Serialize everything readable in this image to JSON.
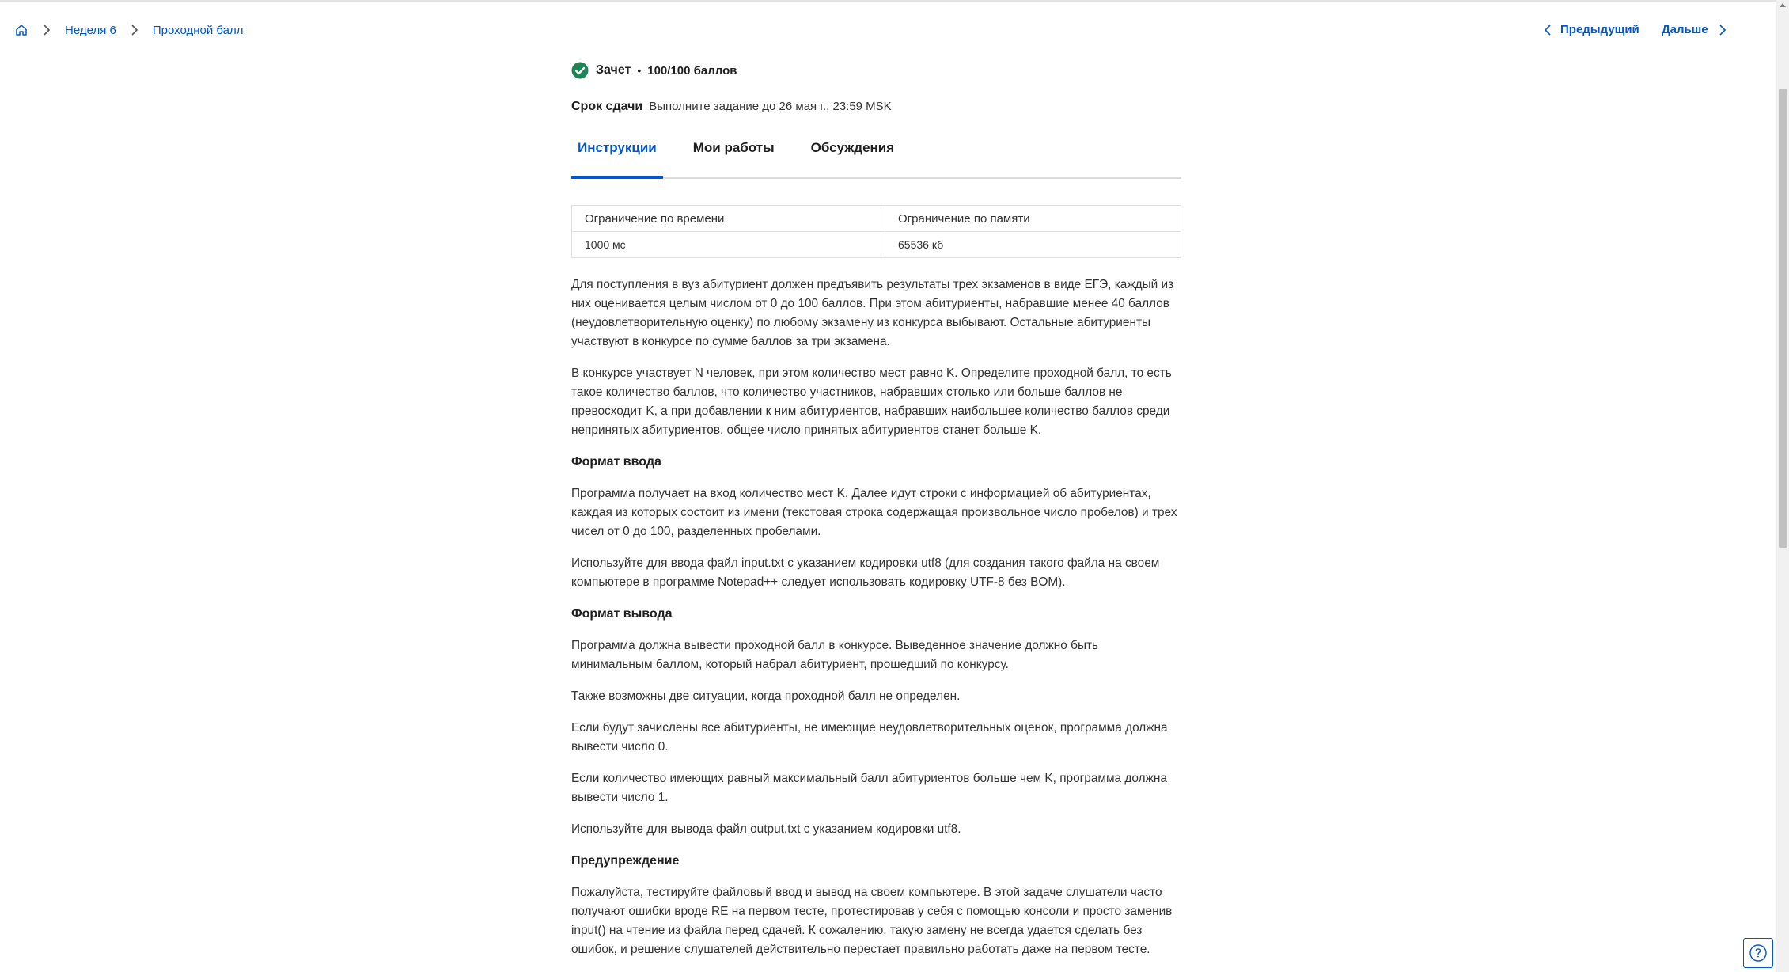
{
  "breadcrumb": {
    "items": [
      {
        "label": "Неделя 6"
      },
      {
        "label": "Проходной балл"
      }
    ]
  },
  "nav": {
    "prev_label": "Предыдущий",
    "next_label": "Дальше"
  },
  "status": {
    "label": "Зачет",
    "separator": "•",
    "score": "100/100 баллов",
    "color": "#1f8354"
  },
  "deadline": {
    "label": "Срок сдачи",
    "text": "Выполните задание до 26 мая г., 23:59 MSK"
  },
  "tabs": [
    {
      "label": "Инструкции",
      "active": true
    },
    {
      "label": "Мои работы",
      "active": false
    },
    {
      "label": "Обсуждения",
      "active": false
    }
  ],
  "limits": {
    "headers": [
      "Ограничение по времени",
      "Ограничение по памяти"
    ],
    "values": [
      "1000 мс",
      "65536 кб"
    ]
  },
  "instructions": {
    "p1": "Для поступления в вуз абитуриент должен предъявить результаты трех экзаменов в виде ЕГЭ, каждый из них оценивается целым числом от 0 до 100 баллов. При этом абитуриенты, набравшие менее 40 баллов (неудовлетворительную оценку) по любому экзамену из конкурса выбывают. Остальные абитуриенты участвуют в конкурсе по сумме баллов за три экзамена.",
    "p2": "В конкурсе участвует N человек, при этом количество мест равно K. Определите проходной балл, то есть такое количество баллов, что количество участников, набравших столько или больше баллов не превосходит K, а при добавлении к ним абитуриентов, набравших наибольшее количество баллов среди непринятых абитуриентов, общее число принятых абитуриентов станет больше K.",
    "h_input": "Формат ввода",
    "p3": "Программа получает на вход количество мест K. Далее идут строки с информацией об абитуриентах, каждая из которых состоит из имени (текстовая строка содержащая произвольное число пробелов) и трех чисел от 0 до 100, разделенных пробелами.",
    "p4": "Используйте для ввода файл input.txt с указанием кодировки utf8 (для создания такого файла на своем компьютере в программе Notepad++ следует использовать кодировку UTF-8 без BOM).",
    "h_output": "Формат вывода",
    "p5": "Программа должна вывести проходной балл в конкурсе. Выведенное значение должно быть минимальным баллом, который набрал абитуриент, прошедший по конкурсу.",
    "p6": "Также возможны две ситуации, когда проходной балл не определен.",
    "p7": "Если будут зачислены все абитуриенты, не имеющие неудовлетворительных оценок, программа должна вывести число 0.",
    "p8": "Если количество имеющих равный максимальный балл абитуриентов больше чем K, программа должна вывести число 1.",
    "p9": "Используйте для вывода файл output.txt с указанием кодировки utf8.",
    "h_warning": "Предупреждение",
    "p10": "Пожалуйста, тестируйте файловый ввод и вывод на своем компьютере. В этой задаче слушатели часто получают ошибки вроде RE на первом тесте, протестировав у себя с помощью консоли и просто заменив input() на чтение из файла перед сдачей. К сожалению, такую замену не всегда удается сделать без ошибок, и решение слушателей действительно перестает правильно работать даже на первом тесте."
  },
  "colors": {
    "accent": "#0056d2",
    "text": "#1f1f1f"
  },
  "icons": {
    "home": "home-icon",
    "chevron": "chevron-right-icon",
    "check": "check-circle-icon",
    "help": "help-icon"
  }
}
